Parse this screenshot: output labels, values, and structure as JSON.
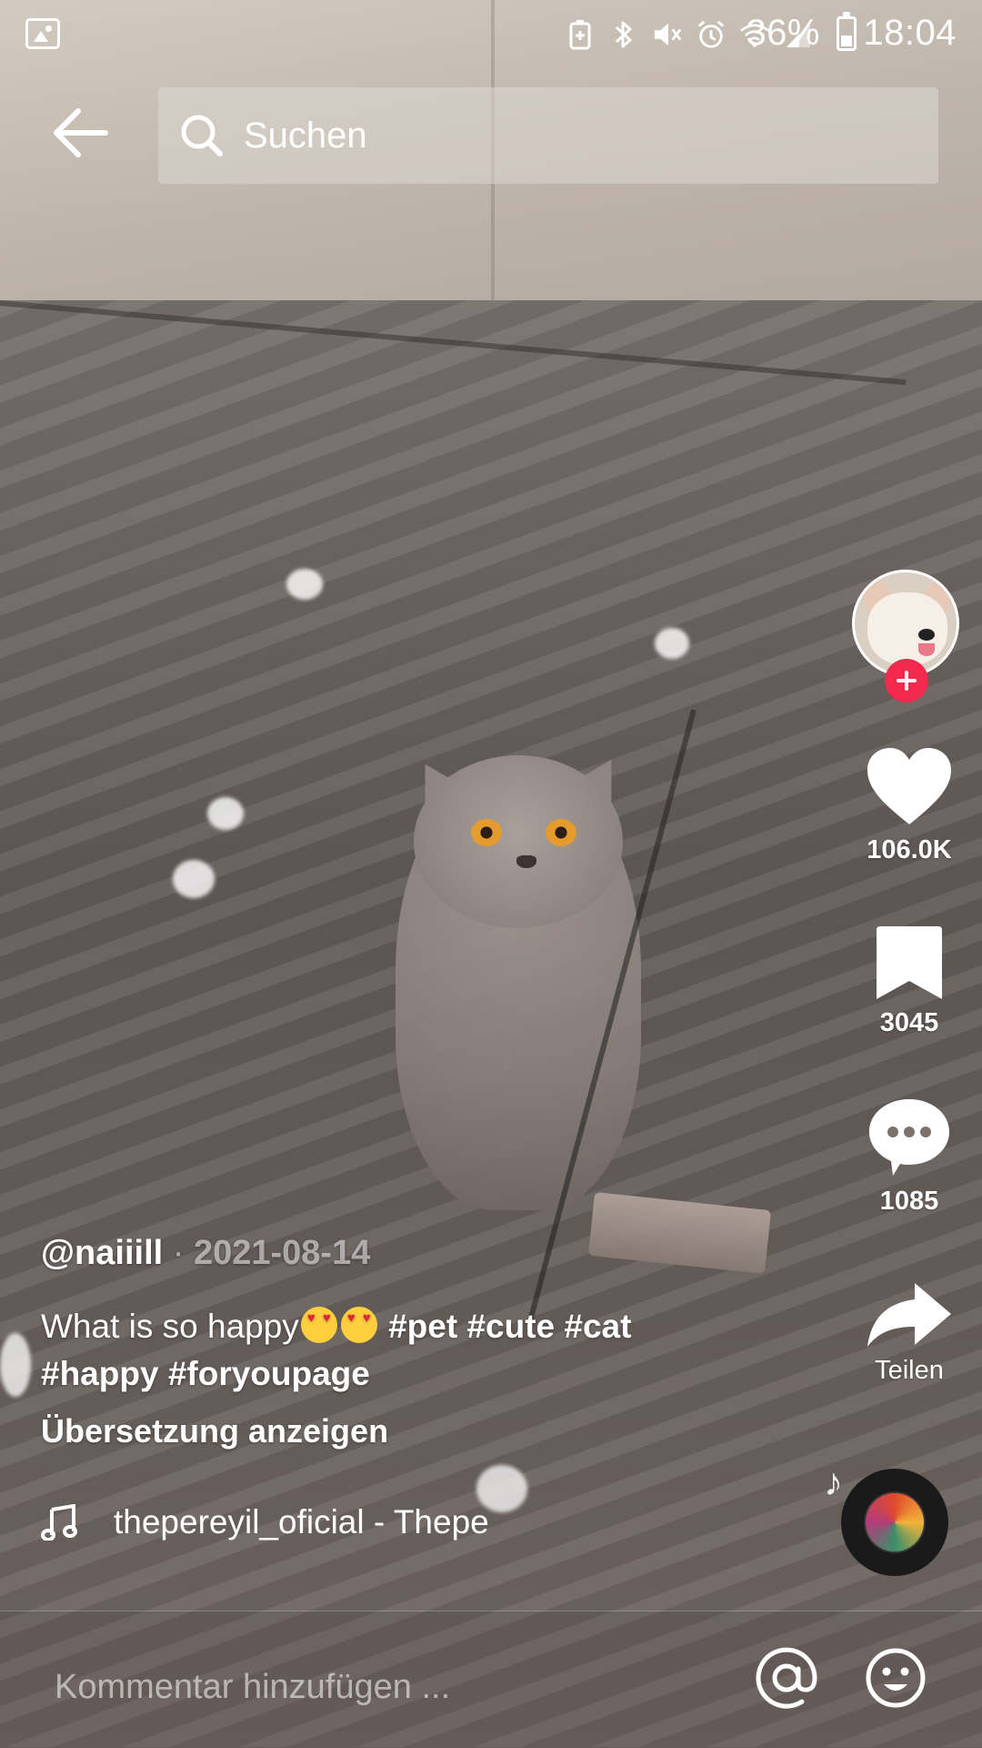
{
  "status_bar": {
    "battery": "36%",
    "time": "18:04",
    "icons": [
      "gallery-icon",
      "battery-saver-icon",
      "bluetooth-icon",
      "mute-icon",
      "alarm-icon",
      "wifi-icon",
      "signal-icon",
      "battery-icon"
    ]
  },
  "search": {
    "placeholder": "Suchen"
  },
  "actions": {
    "likes": "106.0K",
    "bookmarks": "3045",
    "comments": "1085",
    "share_label": "Teilen"
  },
  "post": {
    "author": "@naiiill",
    "separator": "·",
    "date": "2021-08-14",
    "caption_text": "What is so happy",
    "emojis": [
      "heart-eyes-emoji",
      "heart-eyes-emoji"
    ],
    "hashtags_line1": "#pet #cute #cat",
    "hashtags_line2": "#happy #foryoupage",
    "translate_label": "Übersetzung anzeigen",
    "music": "thepereyil_oficial - Thepe"
  },
  "comment": {
    "placeholder": "Kommentar hinzufügen ..."
  },
  "colors": {
    "follow_accent": "#f2284d",
    "emoji_yellow": "#ffcf3d"
  }
}
